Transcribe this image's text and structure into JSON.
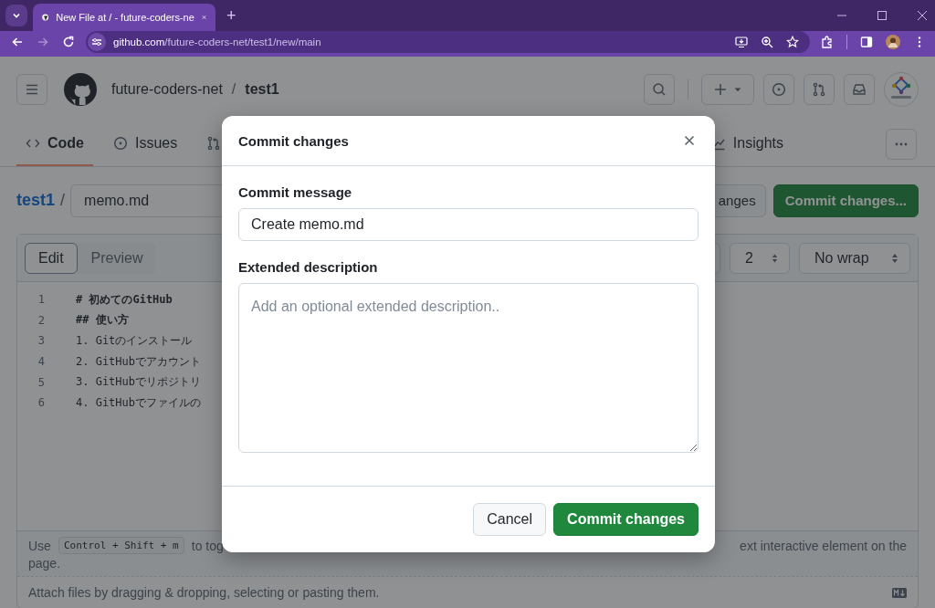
{
  "browser": {
    "tab": {
      "title": "New File at / - future-coders-ne",
      "selected": true
    },
    "new_tab": "+",
    "url": {
      "host": "github.com",
      "path": "/future-coders-net/test1/new/main"
    }
  },
  "header": {
    "owner": "future-coders-net",
    "separator": "/",
    "repo": "test1"
  },
  "repo_nav": [
    {
      "kind": "code",
      "label": "Code",
      "selected": true
    },
    {
      "kind": "issue",
      "label": "Issues",
      "selected": false
    },
    {
      "kind": "pull",
      "selected": false
    },
    {
      "kind": "graph",
      "label": "Insights",
      "selected": false
    }
  ],
  "breadcrumb": {
    "repo": "test1",
    "separator": "/",
    "filename": "memo.md"
  },
  "actions": [
    {
      "kind": "secondary",
      "label": "anges"
    },
    {
      "kind": "primary",
      "label": "Commit changes..."
    }
  ],
  "editor": {
    "tabs": [
      {
        "label": "Edit",
        "selected": true
      },
      {
        "label": "Preview",
        "selected": false
      }
    ],
    "indent_size": "2",
    "wrap_mode": "No wrap",
    "lines": [
      {
        "number": "1",
        "kind": "heading",
        "text": "# 初めてのGitHub"
      },
      {
        "number": "2",
        "kind": "heading",
        "text": "## 使い方"
      },
      {
        "number": "3",
        "kind": "text",
        "text": "1. Gitのインストール"
      },
      {
        "number": "4",
        "kind": "text",
        "text": "2. GitHubでアカウント"
      },
      {
        "number": "5",
        "kind": "text",
        "text": "3. GitHubでリポジトリ"
      },
      {
        "number": "6",
        "kind": "text",
        "text": "4. GitHubでファイルの"
      }
    ],
    "hint": {
      "before": "Use",
      "shortcut": "Control + Shift + m",
      "after": "to tog",
      "right": "ext interactive element on the",
      "continued": "page."
    },
    "attach": "Attach files by dragging & dropping, selecting or pasting them."
  },
  "dialog": {
    "title": "Commit changes",
    "fields": [
      {
        "kind": "input",
        "label": "Commit message",
        "value": "Create memo.md"
      },
      {
        "kind": "textarea",
        "label": "Extended description",
        "placeholder": "Add an optional extended description.."
      }
    ],
    "buttons": [
      {
        "kind": "secondary",
        "label": "Cancel"
      },
      {
        "kind": "primary",
        "label": "Commit changes"
      }
    ]
  }
}
